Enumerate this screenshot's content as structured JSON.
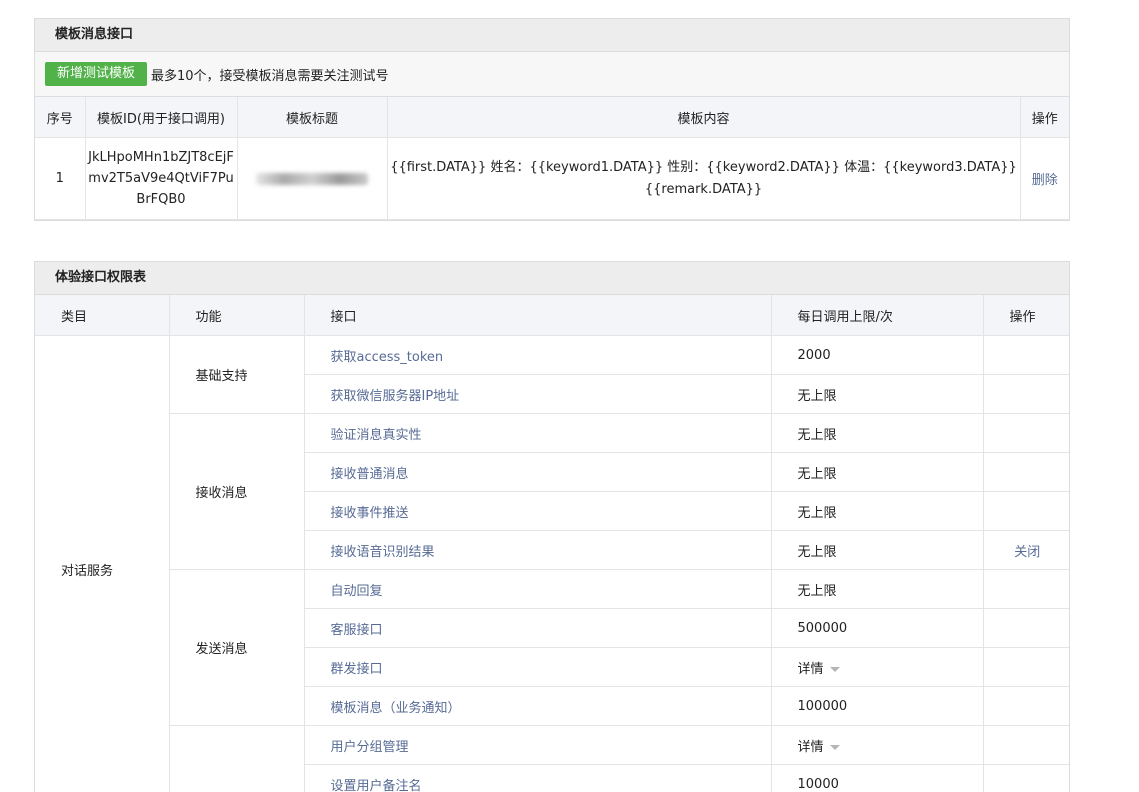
{
  "template_panel": {
    "title": "模板消息接口",
    "add_button": "新增测试模板",
    "note": "最多10个，接受模板消息需要关注测试号",
    "headers": [
      "序号",
      "模板ID(用于接口调用)",
      "模板标题",
      "模板内容",
      "操作"
    ],
    "rows": [
      {
        "index": "1",
        "template_id": "JkLHpoMHn1bZJT8cEjFmv2T5aV9e4QtViF7PuBrFQB0",
        "content": "{{first.DATA}} 姓名：{{keyword1.DATA}} 性别：{{keyword2.DATA}} 体温：{{keyword3.DATA}} {{remark.DATA}}",
        "action": "删除"
      }
    ]
  },
  "permission_panel": {
    "title": "体验接口权限表",
    "headers": [
      "类目",
      "功能",
      "接口",
      "每日调用上限/次",
      "操作"
    ],
    "category": "对话服务",
    "groups": [
      {
        "function": "基础支持",
        "rows": [
          {
            "api": "获取access_token",
            "limit": "2000"
          },
          {
            "api": "获取微信服务器IP地址",
            "limit": "无上限"
          }
        ]
      },
      {
        "function": "接收消息",
        "rows": [
          {
            "api": "验证消息真实性",
            "limit": "无上限"
          },
          {
            "api": "接收普通消息",
            "limit": "无上限"
          },
          {
            "api": "接收事件推送",
            "limit": "无上限"
          },
          {
            "api": "接收语音识别结果",
            "limit": "无上限",
            "action": "关闭"
          }
        ]
      },
      {
        "function": "发送消息",
        "rows": [
          {
            "api": "自动回复",
            "limit": "无上限"
          },
          {
            "api": "客服接口",
            "limit": "500000"
          },
          {
            "api": "群发接口",
            "limit": "详情"
          },
          {
            "api": "模板消息（业务通知）",
            "limit": "100000"
          }
        ]
      },
      {
        "function": "",
        "rows": [
          {
            "api": "用户分组管理",
            "limit": "详情"
          },
          {
            "api": "设置用户备注名",
            "limit": "10000"
          }
        ]
      }
    ]
  },
  "colors": {
    "accent_green": "#52b24a",
    "link_blue": "#576b95",
    "header_bg": "#ededed"
  }
}
